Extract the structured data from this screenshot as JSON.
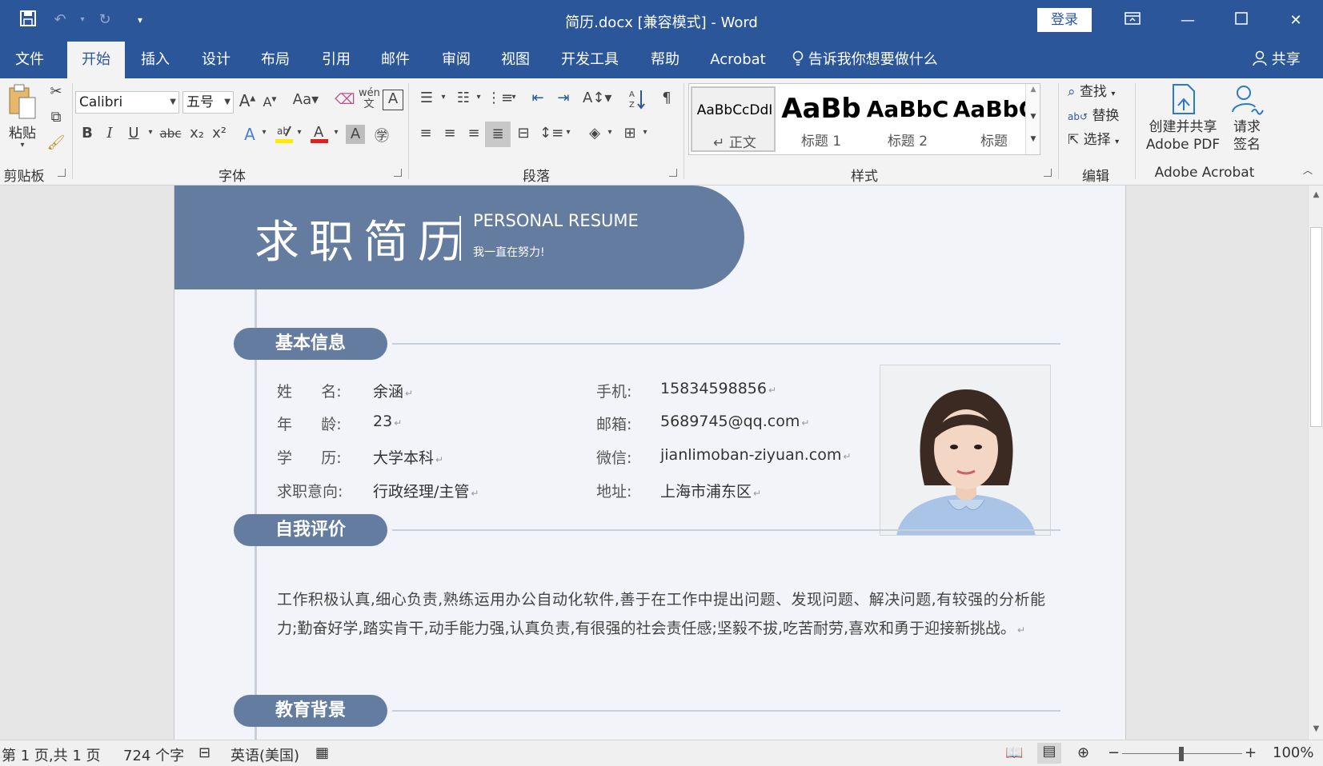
{
  "app": {
    "title": "简历.docx [兼容模式]  -  Word",
    "login_label": "登录",
    "colors": {
      "brand": "#2b579a",
      "resume_accent": "#637c9f"
    }
  },
  "quick_access": {
    "save_icon": "save-icon",
    "undo_icon": "undo-icon",
    "redo_icon": "redo-icon",
    "customize_icon": "chevron-down-icon"
  },
  "tabs": [
    "文件",
    "开始",
    "插入",
    "设计",
    "布局",
    "引用",
    "邮件",
    "审阅",
    "视图",
    "开发工具",
    "帮助",
    "Acrobat"
  ],
  "active_tab": "开始",
  "tell_me": "告诉我你想要做什么",
  "share_label": "共享",
  "ribbon": {
    "clipboard": {
      "paste": "粘贴",
      "label": "剪贴板"
    },
    "font": {
      "font_name": "Calibri",
      "font_size": "五号",
      "label": "字体",
      "bold": "B",
      "italic": "I",
      "underline": "U",
      "strike": "abc",
      "subscript": "x₂",
      "superscript": "x²",
      "change_case": "Aa",
      "grow": "A",
      "shrink": "A"
    },
    "paragraph": {
      "label": "段落"
    },
    "styles": {
      "label": "样式",
      "items": [
        {
          "sample": "AaBbCcDdI",
          "name": "↵ 正文"
        },
        {
          "sample": "AaBb",
          "name": "标题 1"
        },
        {
          "sample": "AaBbC",
          "name": "标题 2"
        },
        {
          "sample": "AaBbC",
          "name": "标题"
        }
      ]
    },
    "editing": {
      "find": "查找",
      "replace": "替换",
      "select": "选择",
      "label": "编辑"
    },
    "acrobat": {
      "create_pdf_line1": "创建并共享",
      "create_pdf_line2": "Adobe PDF",
      "request_line1": "请求",
      "request_line2": "签名",
      "label": "Adobe Acrobat"
    }
  },
  "resume": {
    "banner_title": "求职简历",
    "banner_en": "PERSONAL RESUME",
    "banner_sub": "我一直在努力!",
    "sections": {
      "basic": "基本信息",
      "self_eval": "自我评价",
      "education": "教育背景"
    },
    "left_info": [
      {
        "label": "姓      名:",
        "value": "余涵"
      },
      {
        "label": "年      龄:",
        "value": "23"
      },
      {
        "label": "学      历:",
        "value": "大学本科"
      },
      {
        "label": "求职意向:",
        "value": "行政经理/主管"
      }
    ],
    "right_info": [
      {
        "label": "手机:",
        "value": "15834598856"
      },
      {
        "label": "邮箱:",
        "value": "5689745@qq.com"
      },
      {
        "label": "微信:",
        "value": "jianlimoban-ziyuan.com"
      },
      {
        "label": "地址:",
        "value": "上海市浦东区"
      }
    ],
    "self_eval_text": "工作积极认真,细心负责,熟练运用办公自动化软件,善于在工作中提出问题、发现问题、解决问题,有较强的分析能力;勤奋好学,踏实肯干,动手能力强,认真负责,有很强的社会责任感;坚毅不拔,吃苦耐劳,喜欢和勇于迎接新挑战。",
    "para_mark": "↵"
  },
  "status": {
    "page": "第 1 页,共 1 页",
    "words": "724 个字",
    "language": "英语(美国)",
    "zoom": "100%",
    "zoom_fraction": 0.5
  }
}
